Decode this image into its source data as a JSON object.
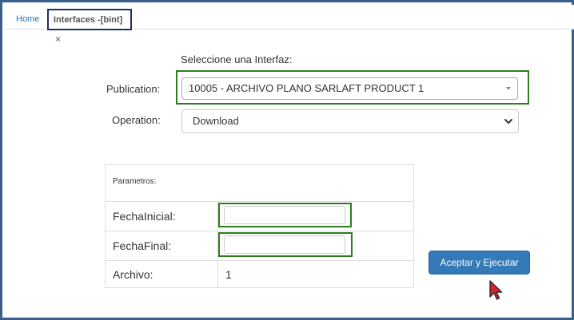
{
  "tabs": {
    "home_label": "Home",
    "active_label": "Interfaces -[bint]",
    "close_glyph": "×"
  },
  "form": {
    "prompt": "Seleccione una Interfaz:",
    "publication_label": "Publication:",
    "publication_value": "10005 - ARCHIVO PLANO SARLAFT PRODUCT 1",
    "operation_label": "Operation:",
    "operation_value": "Download"
  },
  "params": {
    "title": "Parametros:",
    "rows": [
      {
        "key": "FechaInicial:",
        "value": ""
      },
      {
        "key": "FechaFinal:",
        "value": ""
      },
      {
        "key": "Archivo:",
        "value": "1"
      }
    ]
  },
  "actions": {
    "execute_label": "Aceptar y Ejecutar"
  },
  "colors": {
    "frame_border": "#3a5f8c",
    "highlight_green": "#2d7d1e",
    "active_tab_border": "#1d2e6b",
    "button_bg": "#3479b8",
    "link_blue": "#2a6fb5",
    "cursor_red": "#d4242a"
  },
  "icons": {
    "tab_close": "close-icon",
    "publication_caret": "caret-down-icon",
    "operation_chevron": "chevron-down-icon",
    "mouse_cursor": "mouse-pointer-icon"
  }
}
